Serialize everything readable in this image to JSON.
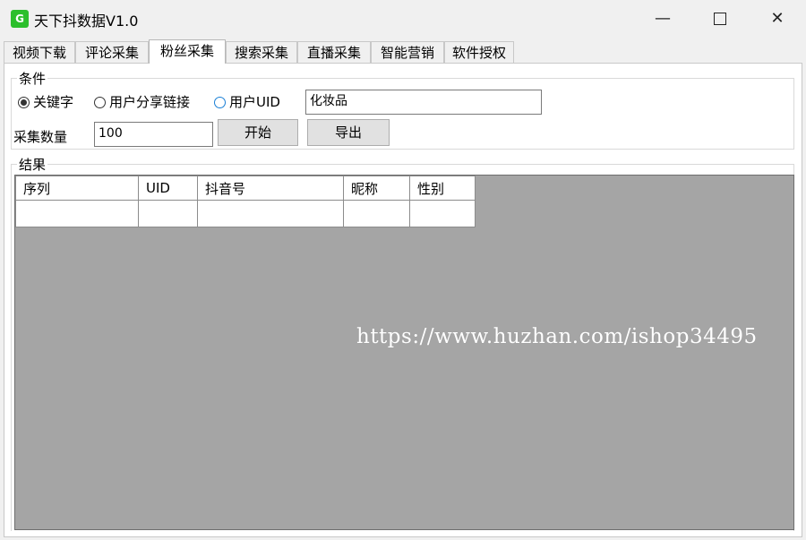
{
  "window": {
    "icon_text": "G",
    "title": "天下抖数据V1.0",
    "minimize_glyph": "—",
    "close_glyph": "✕"
  },
  "tabs": [
    {
      "label": "视频下载"
    },
    {
      "label": "评论采集"
    },
    {
      "label": "粉丝采集",
      "active": true
    },
    {
      "label": "搜索采集"
    },
    {
      "label": "直播采集"
    },
    {
      "label": "智能营销"
    },
    {
      "label": "软件授权"
    }
  ],
  "conditions": {
    "legend": "条件",
    "radio_keyword": "关键字",
    "radio_share_link": "用户分享链接",
    "radio_uid": "用户UID",
    "selected": "关键字",
    "keyword_value": "化妆品",
    "count_label": "采集数量",
    "count_value": "100",
    "start_button": "开始",
    "export_button": "导出"
  },
  "results": {
    "legend": "结果",
    "columns": [
      "序列",
      "UID",
      "抖音号",
      "昵称",
      "性别"
    ]
  },
  "watermark": "https://www.huzhan.com/ishop34495",
  "colors": {
    "app_icon": "#2cbf2c",
    "grid_background": "#a5a5a5",
    "radio_hover": "#1a7fd6"
  }
}
